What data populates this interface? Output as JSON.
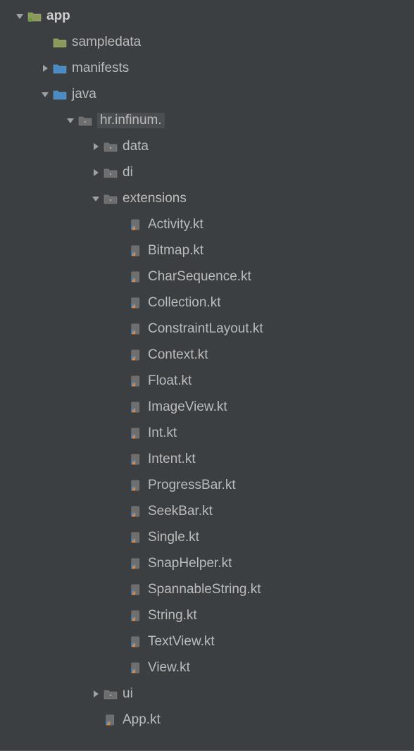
{
  "tree": {
    "app": {
      "label": "app",
      "expanded": true,
      "iconType": "module-folder",
      "bold": true,
      "children": {
        "sampledata": {
          "label": "sampledata",
          "iconType": "res-folder",
          "arrow": "none"
        },
        "manifests": {
          "label": "manifests",
          "iconType": "source-folder",
          "arrow": "collapsed"
        },
        "java": {
          "label": "java",
          "iconType": "source-folder",
          "expanded": true,
          "children": {
            "pkg": {
              "label": "hr.infinum.",
              "iconType": "package-folder",
              "expanded": true,
              "highlight": true,
              "children": {
                "data": {
                  "label": "data",
                  "iconType": "package-folder",
                  "arrow": "collapsed"
                },
                "di": {
                  "label": "di",
                  "iconType": "package-folder",
                  "arrow": "collapsed"
                },
                "extensions": {
                  "label": "extensions",
                  "iconType": "package-folder",
                  "expanded": true,
                  "files": [
                    "Activity.kt",
                    "Bitmap.kt",
                    "CharSequence.kt",
                    "Collection.kt",
                    "ConstraintLayout.kt",
                    "Context.kt",
                    "Float.kt",
                    "ImageView.kt",
                    "Int.kt",
                    "Intent.kt",
                    "ProgressBar.kt",
                    "SeekBar.kt",
                    "Single.kt",
                    "SnapHelper.kt",
                    "SpannableString.kt",
                    "String.kt",
                    "TextView.kt",
                    "View.kt"
                  ]
                },
                "ui": {
                  "label": "ui",
                  "iconType": "package-folder",
                  "arrow": "collapsed"
                },
                "appkt": {
                  "label": "App.kt",
                  "iconType": "kt-file",
                  "arrow": "none"
                }
              }
            }
          }
        }
      }
    }
  },
  "indentStep": 36,
  "baseIndent": 18
}
